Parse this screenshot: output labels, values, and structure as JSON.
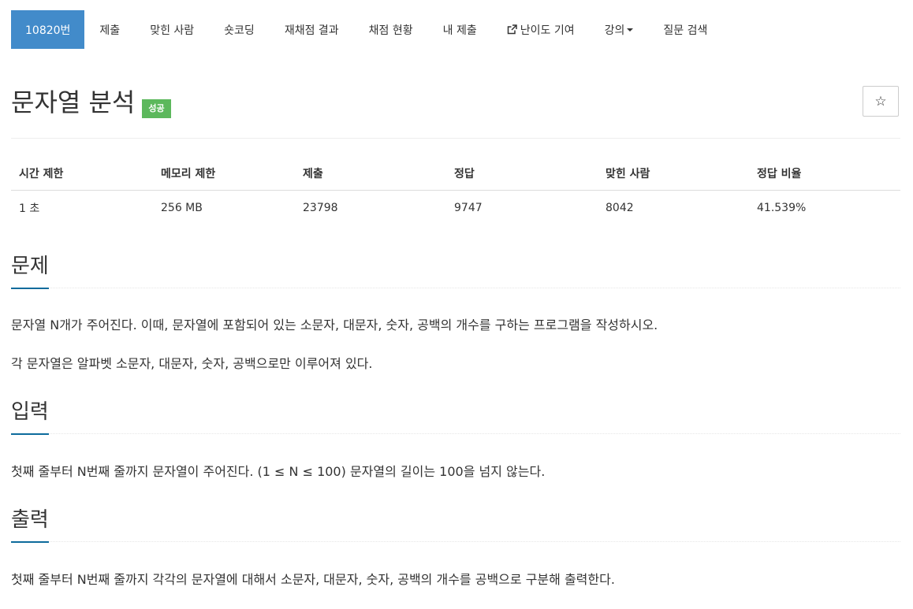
{
  "nav": {
    "problem_number": "10820번",
    "items": [
      {
        "label": "제출"
      },
      {
        "label": "맞힌 사람"
      },
      {
        "label": "숏코딩"
      },
      {
        "label": "재채점 결과"
      },
      {
        "label": "채점 현황"
      },
      {
        "label": "내 제출"
      },
      {
        "label": "난이도 기여",
        "icon": "external-link-icon"
      },
      {
        "label": "강의",
        "icon": "caret-down-icon"
      },
      {
        "label": "질문 검색"
      }
    ]
  },
  "problem": {
    "title": "문자열 분석",
    "status_badge": "성공",
    "status_color": "#5cb85c",
    "star_icon": "☆"
  },
  "stats": {
    "headers": [
      "시간 제한",
      "메모리 제한",
      "제출",
      "정답",
      "맞힌 사람",
      "정답 비율"
    ],
    "values": [
      "1 초",
      "256 MB",
      "23798",
      "9747",
      "8042",
      "41.539%"
    ]
  },
  "sections": {
    "description": {
      "heading": "문제",
      "paragraphs": [
        "문자열 N개가 주어진다. 이때, 문자열에 포함되어 있는 소문자, 대문자, 숫자, 공백의 개수를 구하는 프로그램을 작성하시오.",
        "각 문자열은 알파벳 소문자, 대문자, 숫자, 공백으로만 이루어져 있다."
      ]
    },
    "input": {
      "heading": "입력",
      "paragraphs": [
        "첫째 줄부터 N번째 줄까지 문자열이 주어진다. (1 ≤ N ≤ 100) 문자열의 길이는 100을 넘지 않는다."
      ]
    },
    "output": {
      "heading": "출력",
      "paragraphs": [
        "첫째 줄부터 N번째 줄까지 각각의 문자열에 대해서 소문자, 대문자, 숫자, 공백의 개수를 공백으로 구분해 출력한다."
      ]
    }
  },
  "colors": {
    "accent": "#428bca",
    "success": "#5cb85c",
    "section_underline": "#0d6b9c"
  }
}
